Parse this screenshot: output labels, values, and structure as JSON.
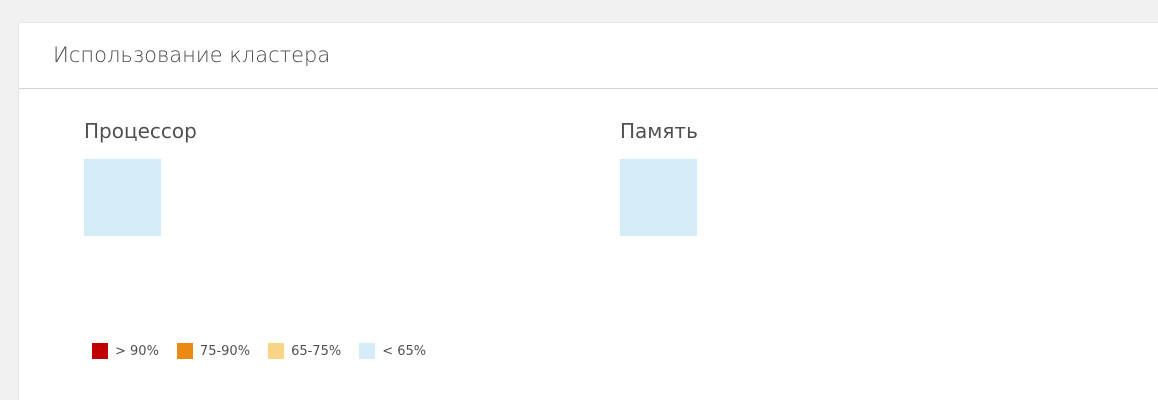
{
  "card": {
    "title": "Использование кластера"
  },
  "sections": [
    {
      "title": "Процессор",
      "cell_color": "#d4ecf7"
    },
    {
      "title": "Память",
      "cell_color": "#d4ecf7"
    }
  ],
  "legend": [
    {
      "label": "> 90%",
      "color": "#c00000"
    },
    {
      "label": "75-90%",
      "color": "#ea8a12"
    },
    {
      "label": "65-75%",
      "color": "#f7d486"
    },
    {
      "label": "< 65%",
      "color": "#d4ecf7"
    }
  ]
}
